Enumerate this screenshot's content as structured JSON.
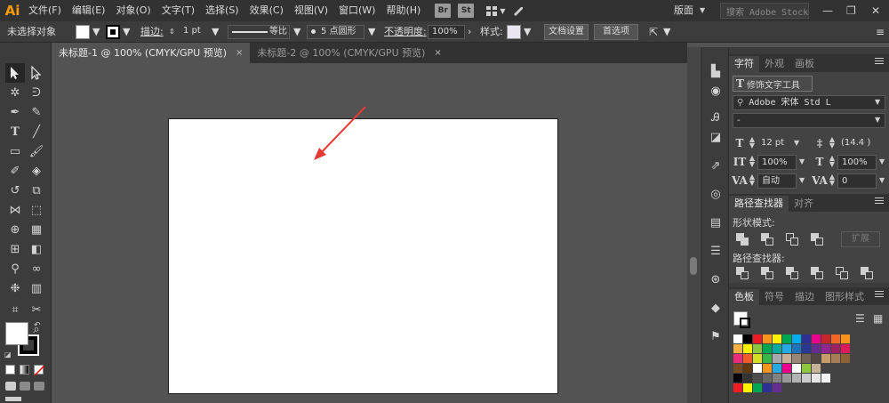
{
  "app": {
    "logo": "Ai"
  },
  "menu": [
    "文件(F)",
    "编辑(E)",
    "对象(O)",
    "文字(T)",
    "选择(S)",
    "效果(C)",
    "视图(V)",
    "窗口(W)",
    "帮助(H)"
  ],
  "bridge": {
    "br": "Br",
    "st": "St"
  },
  "workspace": {
    "label": "版面"
  },
  "stock_search": {
    "placeholder": "搜索 Adobe Stock"
  },
  "control_bar": {
    "selection": "未选择对象",
    "stroke_label": "描边:",
    "stroke_weight": "1 pt",
    "stroke_profile": "等比",
    "brush": "5 点圆形",
    "opacity_label": "不透明度:",
    "opacity": "100%",
    "style_label": "样式:",
    "doc_setup": "文档设置",
    "preferences": "首选项"
  },
  "tabs": [
    {
      "label": "未标题-1 @ 100% (CMYK/GPU 预览)",
      "close": "×"
    },
    {
      "label": "未标题-2 @ 100% (CMYK/GPU 预览)",
      "close": "×"
    }
  ],
  "character_panel": {
    "tabs": [
      "字符",
      "外观",
      "画板"
    ],
    "touch_type": "修饰文字工具",
    "font_family": "Adobe 宋体 Std L",
    "font_style": "-",
    "font_size": "12 pt",
    "leading": "(14.4 )",
    "h_scale": "100%",
    "v_scale": "100%",
    "kerning": "自动",
    "tracking": "0"
  },
  "pathfinder_panel": {
    "tabs": [
      "路径查找器",
      "对齐"
    ],
    "shape_modes": "形状模式:",
    "expand": "扩展",
    "pathfinders": "路径查找器:"
  },
  "swatches_panel": {
    "tabs": [
      "色板",
      "符号",
      "描边",
      "图形样式"
    ]
  },
  "colors": {
    "accent_logo": "#ff9a00",
    "arrow": "#e53935",
    "swatch_row1": [
      "#ffffff",
      "#000000",
      "#ed1c24",
      "#f7941d",
      "#fff200",
      "#00a651",
      "#00aeef",
      "#2e3192",
      "#ec008c",
      "#c1272d",
      "#f26522",
      "#f7941d"
    ],
    "swatch_row2": [
      "#fbb040",
      "#fff200",
      "#8dc63f",
      "#00a651",
      "#00a99d",
      "#27aae1",
      "#1c75bc",
      "#2b388f",
      "#662d91",
      "#92278f",
      "#9e1f63",
      "#da1c5c"
    ],
    "swatch_row3": [
      "#ee2a7b",
      "#f15a29",
      "#d7df23",
      "#39b54a",
      "#a7a9ac",
      "#c7b299",
      "#998675",
      "#736357",
      "#534741",
      "#c69c6d",
      "#a67c52",
      "#8c6239"
    ],
    "swatch_row4": [
      "#754c24",
      "#603913",
      "#ffffff",
      "#f7941d",
      "#27aae1",
      "#ec008c",
      "#ffffff",
      "#8dc63f",
      "#c7b299"
    ],
    "swatch_row5": [
      "#000000",
      "#333333",
      "#4d4d4d",
      "#666666",
      "#808080",
      "#999999",
      "#b3b3b3",
      "#cccccc",
      "#e6e6e6",
      "#f2f2f2"
    ],
    "swatch_row6": [
      "#ed1c24",
      "#fff200",
      "#00a651",
      "#2e3192",
      "#662d91"
    ]
  }
}
